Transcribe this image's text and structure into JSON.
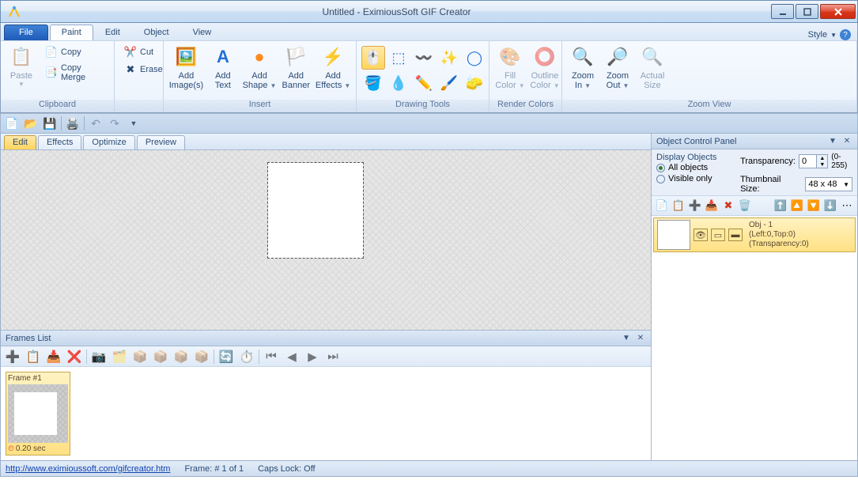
{
  "title": "Untitled - EximiousSoft GIF Creator",
  "tabs": {
    "file": "File",
    "paint": "Paint",
    "edit": "Edit",
    "object": "Object",
    "view": "View",
    "style": "Style"
  },
  "ribbon": {
    "clipboard": {
      "label": "Clipboard",
      "paste": "Paste",
      "copy": "Copy",
      "copymerge": "Copy Merge",
      "cut": "Cut",
      "erase": "Erase"
    },
    "insert": {
      "label": "Insert",
      "addimg": "Add\nImage(s)",
      "addtext": "Add\nText",
      "addshape": "Add\nShape",
      "addbanner": "Add\nBanner",
      "addeffects": "Add\nEffects"
    },
    "drawing": {
      "label": "Drawing Tools"
    },
    "render": {
      "label": "Render Colors",
      "fill": "Fill\nColor",
      "outline": "Outline\nColor"
    },
    "zoom": {
      "label": "Zoom View",
      "zin": "Zoom\nIn",
      "zout": "Zoom\nOut",
      "actual": "Actual\nSize"
    }
  },
  "viewtabs": {
    "edit": "Edit",
    "effects": "Effects",
    "optimize": "Optimize",
    "preview": "Preview"
  },
  "frames": {
    "title": "Frames List",
    "frame1": "Frame #1",
    "dur": "0.20 sec"
  },
  "objpanel": {
    "title": "Object Control Panel",
    "display": "Display Objects",
    "all": "All objects",
    "visible": "Visible only",
    "transp": "Transparency:",
    "transp_val": "0",
    "transp_range": "(0-255)",
    "thumb": "Thumbnail Size:",
    "thumb_val": "48 x 48",
    "obj_name": "Obj - 1",
    "obj_pos": "(Left:0,Top:0)",
    "obj_tr": "(Transparency:0)"
  },
  "status": {
    "url": "http://www.eximioussoft.com/gifcreator.htm",
    "frame": "Frame: # 1 of 1",
    "caps": "Caps Lock: Off"
  }
}
